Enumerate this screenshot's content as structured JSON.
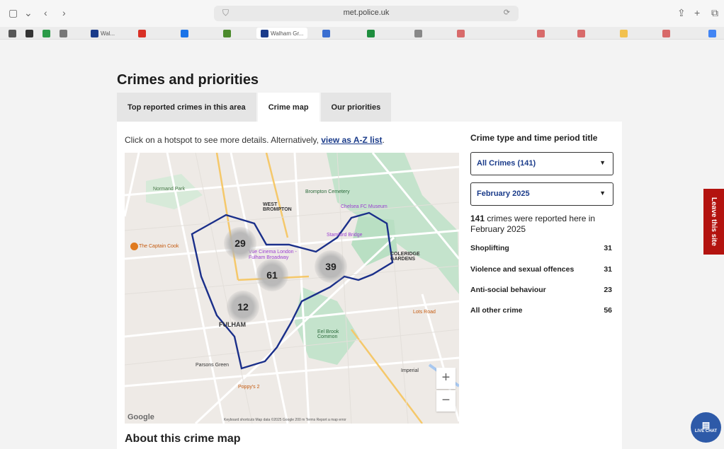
{
  "browser": {
    "url": "met.police.uk",
    "tabs": [
      {
        "label": "Wal...",
        "color": "#1a3b8a"
      },
      {
        "label": "",
        "color": "#d93025"
      },
      {
        "label": "",
        "color": "#1a73e8"
      },
      {
        "label": "",
        "color": "#4b8a2c"
      },
      {
        "label": "Walham Gr...",
        "color": "#1a3b8a",
        "active": true
      },
      {
        "label": "",
        "color": "#3b6fd1"
      },
      {
        "label": "",
        "color": "#1e8e3e"
      },
      {
        "label": "",
        "color": "#888888"
      },
      {
        "label": "",
        "color": "#d86a6a"
      },
      {
        "label": "",
        "color": "#d86a6a"
      },
      {
        "label": "",
        "color": "#d86a6a"
      },
      {
        "label": "",
        "color": "#f2c14e"
      },
      {
        "label": "",
        "color": "#d86a6a"
      },
      {
        "label": "",
        "color": "#4285f4"
      }
    ]
  },
  "page": {
    "title": "Crimes and priorities",
    "tabs": [
      "Top reported crimes in this area",
      "Crime map",
      "Our priorities"
    ],
    "intro_text": "Click on a hotspot to see more details. Alternatively, ",
    "intro_link": "view as A-Z list",
    "intro_end": ".",
    "about_heading": "About this crime map"
  },
  "map": {
    "hotspots": [
      "29",
      "61",
      "39",
      "12"
    ],
    "labels": {
      "normand_park": "Normand Park",
      "west_brompton": "WEST\nBROMPTON",
      "brompton_cemetery": "Brompton Cemetery",
      "chelsea_fc": "Chelsea FC Museum",
      "stamford_bridge": "Stamford Bridge",
      "coleridge": "COLERIDGE\nGARDENS",
      "captain_cook": "The Captain Cook",
      "vue_cinema": "Vue Cinema London - Fulham Broadway",
      "fulham": "FULHAM",
      "eel_brook": "Eel Brook Common",
      "parsons_green": "Parsons Green",
      "poppys": "Poppy's 2",
      "lots_road": "Lots Road",
      "imperial": "Imperial"
    },
    "footer": "Keyboard shortcuts   Map data ©2025 Google   200 m          Terms   Report a map error",
    "google": "Google",
    "zoom_in": "+",
    "zoom_out": "−"
  },
  "side": {
    "title": "Crime type and time period title",
    "crime_select": "All Crimes (141)",
    "month_select": "February 2025",
    "summary_count": "141",
    "summary_text": " crimes were reported here in February 2025",
    "rows": [
      {
        "label": "Shoplifting",
        "count": "31"
      },
      {
        "label": "Violence and sexual offences",
        "count": "31"
      },
      {
        "label": "Anti-social behaviour",
        "count": "23"
      },
      {
        "label": "All other crime",
        "count": "56"
      }
    ]
  },
  "leave_site": "Leave this site",
  "live_chat": "LIVE CHAT",
  "colors": {
    "accent": "#1a3b8a",
    "leave": "#b3130f",
    "park": "#b9dfc3",
    "boundary": "#1a2f8a"
  }
}
